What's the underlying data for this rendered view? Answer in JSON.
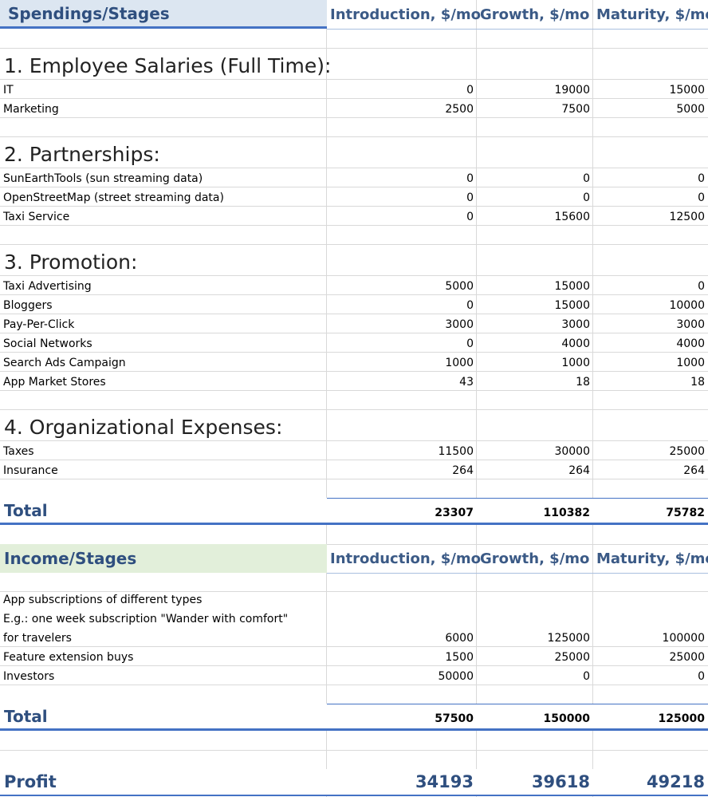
{
  "spend_header": {
    "title": "Spendings/Stages",
    "cols": [
      "Introduction, $/mo",
      "Growth, $/mo",
      "Maturity, $/mo"
    ]
  },
  "sections": {
    "salaries": "1. Employee Salaries (Full Time):",
    "partnerships": "2. Partnerships:",
    "promotion": "3. Promotion:",
    "organizational": "4. Organizational Expenses:"
  },
  "rows": {
    "it": {
      "label": "IT",
      "v": [
        "0",
        "19000",
        "15000"
      ]
    },
    "marketing": {
      "label": "Marketing",
      "v": [
        "2500",
        "7500",
        "5000"
      ]
    },
    "sunearth": {
      "label": "SunEarthTools (sun streaming data)",
      "v": [
        "0",
        "0",
        "0"
      ]
    },
    "osm": {
      "label": "OpenStreetMap (street streaming data)",
      "v": [
        "0",
        "0",
        "0"
      ]
    },
    "taxi_service": {
      "label": "Taxi Service",
      "v": [
        "0",
        "15600",
        "12500"
      ]
    },
    "taxi_ads": {
      "label": "Taxi Advertising",
      "v": [
        "5000",
        "15000",
        "0"
      ]
    },
    "bloggers": {
      "label": "Bloggers",
      "v": [
        "0",
        "15000",
        "10000"
      ]
    },
    "ppc": {
      "label": "Pay-Per-Click",
      "v": [
        "3000",
        "3000",
        "3000"
      ]
    },
    "social": {
      "label": "Social Networks",
      "v": [
        "0",
        "4000",
        "4000"
      ]
    },
    "search_ads": {
      "label": "Search Ads Campaign",
      "v": [
        "1000",
        "1000",
        "1000"
      ]
    },
    "app_market": {
      "label": "App Market Stores",
      "v": [
        "43",
        "18",
        "18"
      ]
    },
    "taxes": {
      "label": "Taxes",
      "v": [
        "11500",
        "30000",
        "25000"
      ]
    },
    "insurance": {
      "label": "Insurance",
      "v": [
        "264",
        "264",
        "264"
      ]
    }
  },
  "spend_total": {
    "label": "Total",
    "v": [
      "23307",
      "110382",
      "75782"
    ]
  },
  "income_header": {
    "title": "Income/Stages",
    "cols": [
      "Introduction, $/mo",
      "Growth, $/mo",
      "Maturity, $/mo"
    ]
  },
  "income_rows": {
    "subs_line1": "App subscriptions of different types",
    "subs_line2": "E.g.: one week subscription \"Wander with comfort\"",
    "subs": {
      "label": "for travelers",
      "v": [
        "6000",
        "125000",
        "100000"
      ]
    },
    "feature": {
      "label": "Feature extension buys",
      "v": [
        "1500",
        "25000",
        "25000"
      ]
    },
    "investors": {
      "label": "Investors",
      "v": [
        "50000",
        "0",
        "0"
      ]
    }
  },
  "income_total": {
    "label": "Total",
    "v": [
      "57500",
      "150000",
      "125000"
    ]
  },
  "profit": {
    "label": "Profit",
    "v": [
      "34193",
      "39618",
      "49218"
    ]
  },
  "colors": {
    "header_blue": "#dce6f1",
    "header_green": "#e2efda",
    "accent": "#4472c4",
    "title_text": "#2f4f7f"
  }
}
